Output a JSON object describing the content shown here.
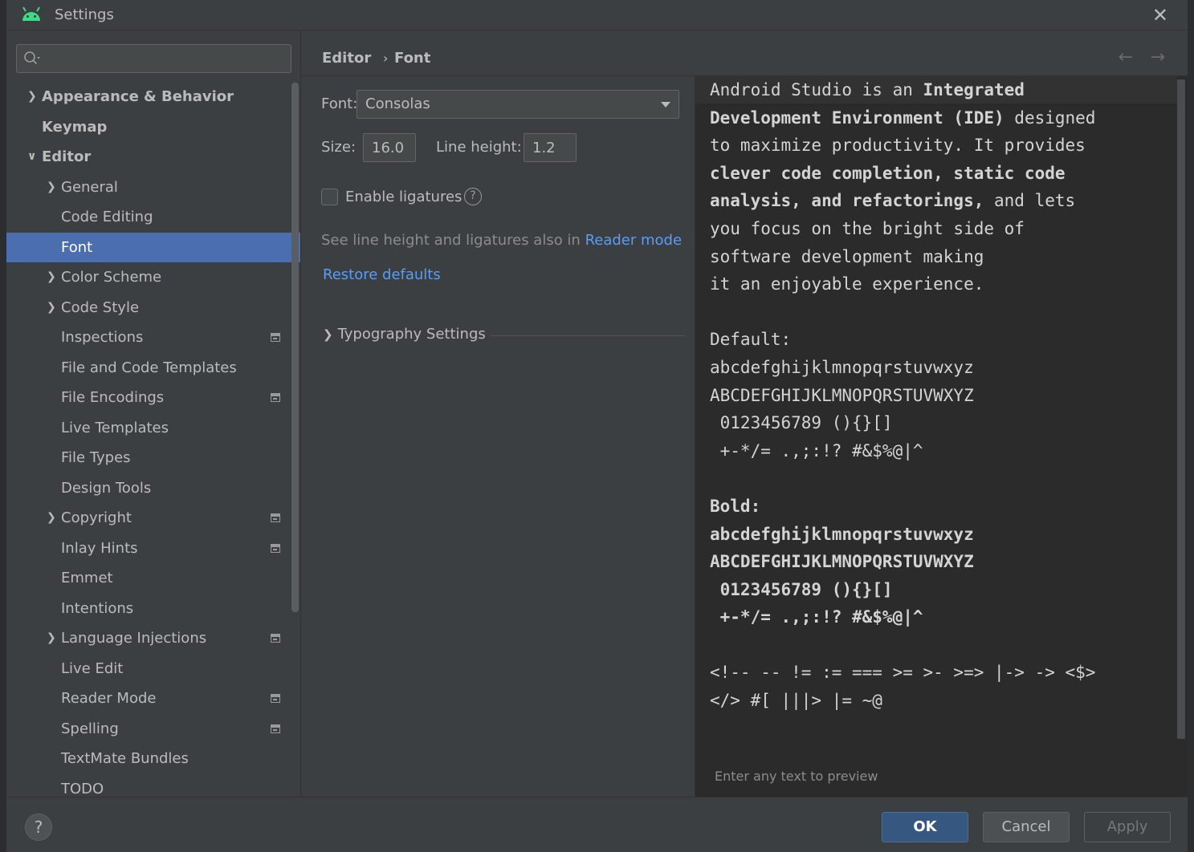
{
  "window": {
    "title": "Settings",
    "close_label": "✕"
  },
  "search": {
    "value": "",
    "placeholder": ""
  },
  "tree": [
    {
      "label": "Appearance & Behavior",
      "level": 0,
      "expandable": true,
      "expanded": false,
      "bold": true,
      "selected": false,
      "project_icon": false
    },
    {
      "label": "Keymap",
      "level": 0,
      "expandable": false,
      "expanded": false,
      "bold": true,
      "selected": false,
      "project_icon": false
    },
    {
      "label": "Editor",
      "level": 0,
      "expandable": true,
      "expanded": true,
      "bold": true,
      "selected": false,
      "project_icon": false
    },
    {
      "label": "General",
      "level": 1,
      "expandable": true,
      "expanded": false,
      "bold": false,
      "selected": false,
      "project_icon": false
    },
    {
      "label": "Code Editing",
      "level": 1,
      "expandable": false,
      "expanded": false,
      "bold": false,
      "selected": false,
      "project_icon": false
    },
    {
      "label": "Font",
      "level": 1,
      "expandable": false,
      "expanded": false,
      "bold": false,
      "selected": true,
      "project_icon": false
    },
    {
      "label": "Color Scheme",
      "level": 1,
      "expandable": true,
      "expanded": false,
      "bold": false,
      "selected": false,
      "project_icon": false
    },
    {
      "label": "Code Style",
      "level": 1,
      "expandable": true,
      "expanded": false,
      "bold": false,
      "selected": false,
      "project_icon": false
    },
    {
      "label": "Inspections",
      "level": 1,
      "expandable": false,
      "expanded": false,
      "bold": false,
      "selected": false,
      "project_icon": true
    },
    {
      "label": "File and Code Templates",
      "level": 1,
      "expandable": false,
      "expanded": false,
      "bold": false,
      "selected": false,
      "project_icon": false
    },
    {
      "label": "File Encodings",
      "level": 1,
      "expandable": false,
      "expanded": false,
      "bold": false,
      "selected": false,
      "project_icon": true
    },
    {
      "label": "Live Templates",
      "level": 1,
      "expandable": false,
      "expanded": false,
      "bold": false,
      "selected": false,
      "project_icon": false
    },
    {
      "label": "File Types",
      "level": 1,
      "expandable": false,
      "expanded": false,
      "bold": false,
      "selected": false,
      "project_icon": false
    },
    {
      "label": "Design Tools",
      "level": 1,
      "expandable": false,
      "expanded": false,
      "bold": false,
      "selected": false,
      "project_icon": false
    },
    {
      "label": "Copyright",
      "level": 1,
      "expandable": true,
      "expanded": false,
      "bold": false,
      "selected": false,
      "project_icon": true
    },
    {
      "label": "Inlay Hints",
      "level": 1,
      "expandable": false,
      "expanded": false,
      "bold": false,
      "selected": false,
      "project_icon": true
    },
    {
      "label": "Emmet",
      "level": 1,
      "expandable": false,
      "expanded": false,
      "bold": false,
      "selected": false,
      "project_icon": false
    },
    {
      "label": "Intentions",
      "level": 1,
      "expandable": false,
      "expanded": false,
      "bold": false,
      "selected": false,
      "project_icon": false
    },
    {
      "label": "Language Injections",
      "level": 1,
      "expandable": true,
      "expanded": false,
      "bold": false,
      "selected": false,
      "project_icon": true
    },
    {
      "label": "Live Edit",
      "level": 1,
      "expandable": false,
      "expanded": false,
      "bold": false,
      "selected": false,
      "project_icon": false
    },
    {
      "label": "Reader Mode",
      "level": 1,
      "expandable": false,
      "expanded": false,
      "bold": false,
      "selected": false,
      "project_icon": true
    },
    {
      "label": "Spelling",
      "level": 1,
      "expandable": false,
      "expanded": false,
      "bold": false,
      "selected": false,
      "project_icon": true
    },
    {
      "label": "TextMate Bundles",
      "level": 1,
      "expandable": false,
      "expanded": false,
      "bold": false,
      "selected": false,
      "project_icon": false
    },
    {
      "label": "TODO",
      "level": 1,
      "expandable": false,
      "expanded": false,
      "bold": false,
      "selected": false,
      "project_icon": false
    }
  ],
  "breadcrumb": {
    "parent": "Editor",
    "separator": "›",
    "current": "Font"
  },
  "nav": {
    "back": "←",
    "forward": "→"
  },
  "font_settings": {
    "font_label": "Font:",
    "font_value": "Consolas",
    "size_label": "Size:",
    "size_value": "16.0",
    "line_height_label": "Line height:",
    "line_height_value": "1.2",
    "ligatures_label": "Enable ligatures",
    "ligatures_checked": false,
    "help_glyph": "?",
    "hint_prefix": "See line height and ligatures also in ",
    "hint_link": "Reader mode",
    "restore_label": "Restore defaults",
    "typography_label": "Typography Settings"
  },
  "preview": {
    "lines": [
      [
        {
          "t": "Android Studio is an ",
          "b": false
        },
        {
          "t": "Integrated",
          "b": true
        }
      ],
      [
        {
          "t": "Development Environment (IDE)",
          "b": true
        },
        {
          "t": " designed",
          "b": false
        }
      ],
      [
        {
          "t": "to maximize productivity. It provides",
          "b": false
        }
      ],
      [
        {
          "t": "clever code completion, static code",
          "b": true
        }
      ],
      [
        {
          "t": "analysis, and refactorings,",
          "b": true
        },
        {
          "t": " and lets",
          "b": false
        }
      ],
      [
        {
          "t": "you focus on the bright side of",
          "b": false
        }
      ],
      [
        {
          "t": "software development making",
          "b": false
        }
      ],
      [
        {
          "t": "it an enjoyable experience.",
          "b": false
        }
      ],
      [
        {
          "t": "",
          "b": false
        }
      ],
      [
        {
          "t": "Default:",
          "b": false
        }
      ],
      [
        {
          "t": "abcdefghijklmnopqrstuvwxyz",
          "b": false
        }
      ],
      [
        {
          "t": "ABCDEFGHIJKLMNOPQRSTUVWXYZ",
          "b": false
        }
      ],
      [
        {
          "t": " 0123456789 (){}[]",
          "b": false
        }
      ],
      [
        {
          "t": " +-*/= .,;:!? #&$%@|^",
          "b": false
        }
      ],
      [
        {
          "t": "",
          "b": false
        }
      ],
      [
        {
          "t": "Bold:",
          "b": true
        }
      ],
      [
        {
          "t": "abcdefghijklmnopqrstuvwxyz",
          "b": true
        }
      ],
      [
        {
          "t": "ABCDEFGHIJKLMNOPQRSTUVWXYZ",
          "b": true
        }
      ],
      [
        {
          "t": " 0123456789 (){}[]",
          "b": true
        }
      ],
      [
        {
          "t": " +-*/= .,;:!? #&$%@|^",
          "b": true
        }
      ],
      [
        {
          "t": "",
          "b": false
        }
      ],
      [
        {
          "t": "<!-- -- != := === >= >- >=> |-> -> <$>",
          "b": false
        }
      ],
      [
        {
          "t": "</> #[ |||> |= ~@",
          "b": false
        }
      ]
    ],
    "hint": "Enter any text to preview"
  },
  "footer": {
    "help_glyph": "?",
    "ok": "OK",
    "cancel": "Cancel",
    "apply": "Apply"
  },
  "colors": {
    "selection": "#4b6eaf",
    "link": "#589df6",
    "ok_button": "#365880",
    "background": "#3c3f41",
    "preview_bg": "#2b2b2b"
  }
}
